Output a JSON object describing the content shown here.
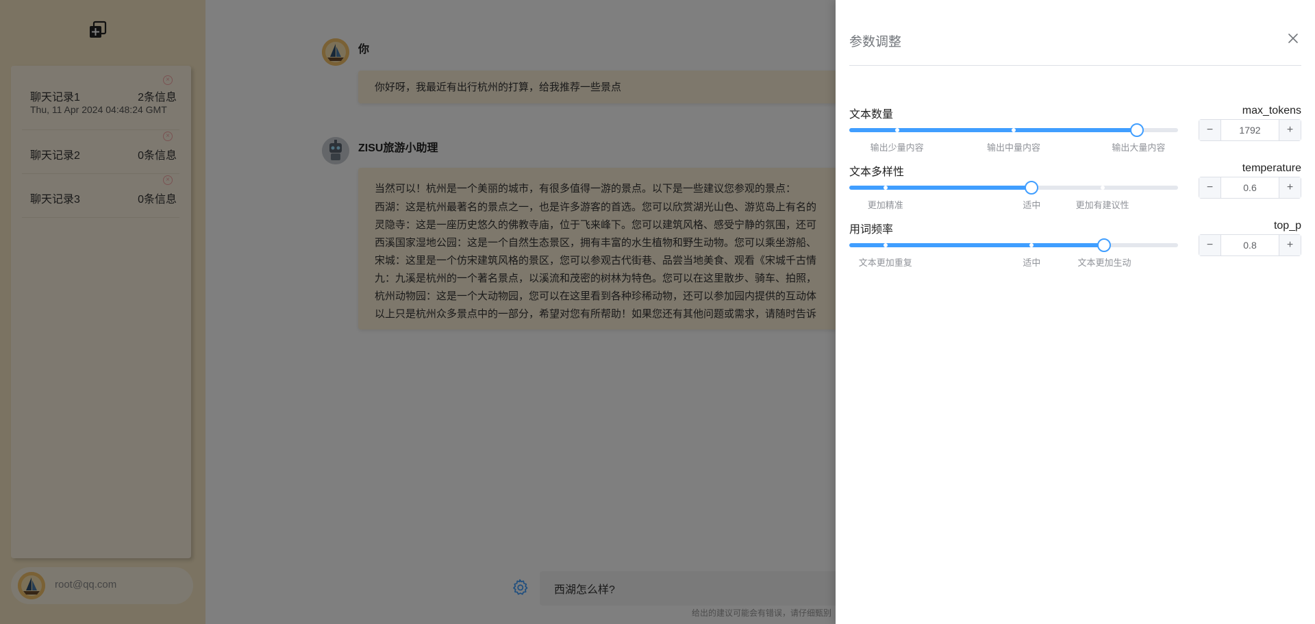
{
  "sidebar": {
    "history": [
      {
        "title": "聊天记录1",
        "count": "2条信息",
        "time": "Thu, 11 Apr 2024 04:48:24 GMT"
      },
      {
        "title": "聊天记录2",
        "count": "0条信息"
      },
      {
        "title": "聊天记录3",
        "count": "0条信息"
      }
    ],
    "delete_glyph": "×",
    "user_email": "root@qq.com"
  },
  "chat": {
    "messages": [
      {
        "sender": "你",
        "lines": [
          "你好呀，我最近有出行杭州的打算，给我推荐一些景点"
        ]
      },
      {
        "sender": "ZISU旅游小助理",
        "lines": [
          "当然可以！杭州是一个美丽的城市，有很多值得一游的景点。以下是一些建议您参观的景点：",
          "西湖：这是杭州最著名的景点之一，也是许多游客的首选。您可以欣赏湖光山色、游览岛上有名的",
          "灵隐寺：这是一座历史悠久的佛教寺庙，位于飞来峰下。您可以建筑风格、感受宁静的氛围，还可",
          "西溪国家湿地公园：这是一个自然生态景区，拥有丰富的水生植物和野生动物。您可以乘坐游船、",
          "宋城：这里是一个仿宋建筑风格的景区，您可以参观古代街巷、品尝当地美食、观看《宋城千古情",
          "九：九溪是杭州的一个著名景点，以溪流和茂密的树林为特色。您可以在这里散步、骑车、拍照，",
          "杭州动物园：这是一个大动物园，您可以在这里看到各种珍稀动物，还可以参加园内提供的互动体",
          "以上只是杭州众多景点中的一部分，希望对您有所帮助！如果您还有其他问题或需求，请随时告诉"
        ]
      }
    ],
    "input_value": "西湖怎么样?",
    "disclaimer": "给出的建议可能会有错误，请仔细甄别"
  },
  "drawer": {
    "title": "参数调整",
    "close_glyph": "×",
    "params": [
      {
        "label": "文本数量",
        "key": "max_tokens",
        "value": "1792",
        "slider_fraction": 0.875,
        "marks": [
          {
            "text": "输出少量内容",
            "at": 0.145
          },
          {
            "text": "输出中量内容",
            "at": 0.5
          },
          {
            "text": "输出大量内容",
            "at": 0.88
          }
        ]
      },
      {
        "label": "文本多样性",
        "key": "temperature",
        "value": "0.6",
        "slider_fraction": 0.555,
        "marks": [
          {
            "text": "更加精准",
            "at": 0.11
          },
          {
            "text": "适中",
            "at": 0.555
          },
          {
            "text": "更加有建议性",
            "at": 0.77
          }
        ]
      },
      {
        "label": "用词频率",
        "key": "top_p",
        "value": "0.8",
        "slider_fraction": 0.776,
        "marks": [
          {
            "text": "文本更加重复",
            "at": 0.11
          },
          {
            "text": "适中",
            "at": 0.555
          },
          {
            "text": "文本更加生动",
            "at": 0.776
          }
        ]
      }
    ],
    "minus_glyph": "−",
    "plus_glyph": "+"
  },
  "colors": {
    "sidebar_bg": "#f7e7c4",
    "bubble_bg": "#fcf0d8",
    "accent": "#409eff",
    "overlay": "rgba(0,0,0,0.5)"
  }
}
